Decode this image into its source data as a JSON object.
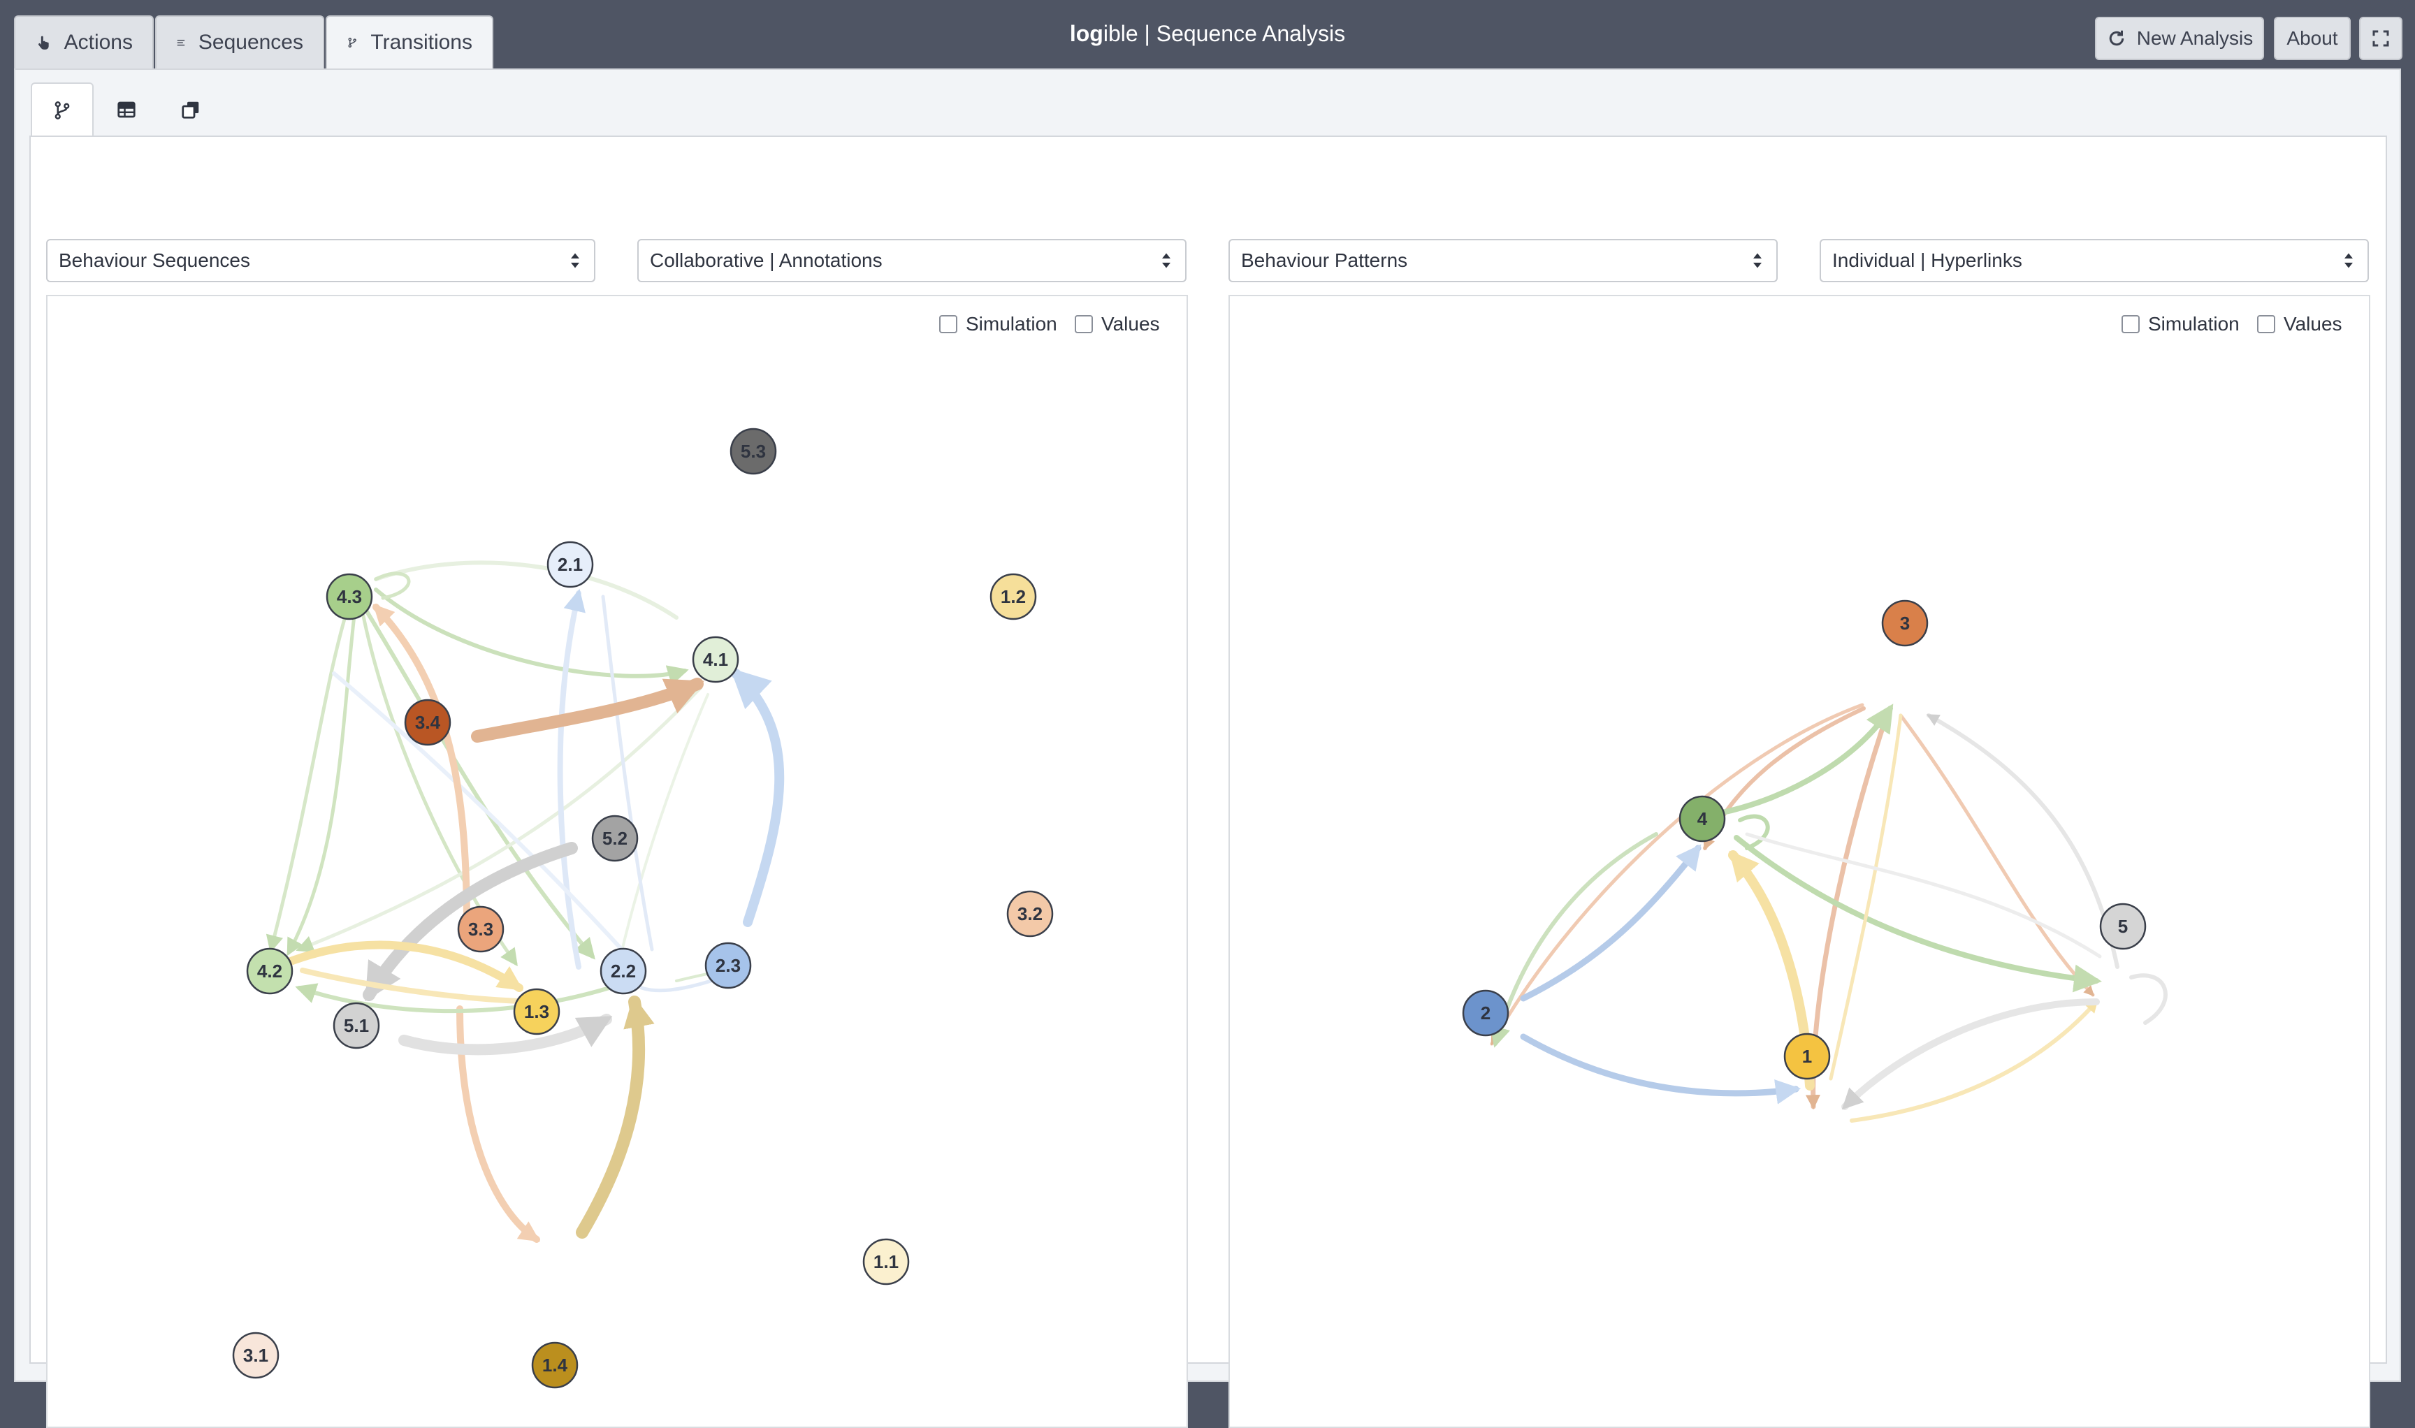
{
  "header": {
    "tabs": [
      {
        "label": "Actions",
        "icon": "hand-pointer-icon"
      },
      {
        "label": "Sequences",
        "icon": "list-lines-icon"
      },
      {
        "label": "Transitions",
        "icon": "branch-icon"
      }
    ],
    "title_brand": "log",
    "title_rest": "ible | Sequence Analysis",
    "buttons": {
      "new_analysis": "New Analysis",
      "about": "About"
    }
  },
  "subtabs": [
    {
      "icon": "branch-icon",
      "active": true
    },
    {
      "icon": "table-icon",
      "active": false
    },
    {
      "icon": "copy-icon",
      "active": false
    }
  ],
  "left": {
    "select_type": "Behaviour Sequences",
    "select_group": "Collaborative | Annotations",
    "simulation_label": "Simulation",
    "values_label": "Values",
    "nodes": [
      {
        "id": "5.3",
        "color": "#6b6b6b"
      },
      {
        "id": "2.1",
        "color": "#e6eefa"
      },
      {
        "id": "1.2",
        "color": "#f6df9a"
      },
      {
        "id": "4.3",
        "color": "#a7cf8b"
      },
      {
        "id": "4.1",
        "color": "#e1efd8"
      },
      {
        "id": "3.4",
        "color": "#b95624"
      },
      {
        "id": "5.2",
        "color": "#a3a3a3"
      },
      {
        "id": "3.2",
        "color": "#f3c9a8"
      },
      {
        "id": "3.3",
        "color": "#eba57c"
      },
      {
        "id": "2.3",
        "color": "#a6c3ea"
      },
      {
        "id": "4.2",
        "color": "#c3e0ae"
      },
      {
        "id": "2.2",
        "color": "#cbdcf3"
      },
      {
        "id": "5.1",
        "color": "#d2d2d2"
      },
      {
        "id": "1.3",
        "color": "#f6d25c"
      },
      {
        "id": "1.1",
        "color": "#fbf0cf"
      },
      {
        "id": "3.1",
        "color": "#f8e6da"
      },
      {
        "id": "1.4",
        "color": "#bb8f1e"
      }
    ]
  },
  "right": {
    "select_type": "Behaviour Patterns",
    "select_group": "Individual | Hyperlinks",
    "simulation_label": "Simulation",
    "values_label": "Values",
    "nodes": [
      {
        "id": "3",
        "color": "#d9804a"
      },
      {
        "id": "4",
        "color": "#84b06a"
      },
      {
        "id": "5",
        "color": "#d5d5d5"
      },
      {
        "id": "2",
        "color": "#6c93cc"
      },
      {
        "id": "1",
        "color": "#f4c341"
      }
    ]
  }
}
